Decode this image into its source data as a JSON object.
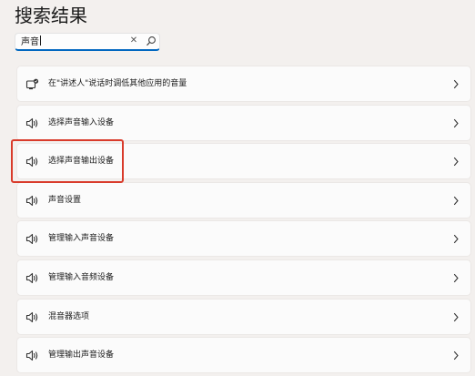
{
  "header": {
    "title": "搜索结果"
  },
  "search": {
    "value": "声音",
    "clear_icon": "close-icon",
    "search_icon": "search-icon"
  },
  "results": [
    {
      "label": "在\"讲述人\"说话时调低其他应用的音量",
      "icon": "narrator-icon"
    },
    {
      "label": "选择声音输入设备",
      "icon": "speaker-icon"
    },
    {
      "label": "选择声音输出设备",
      "icon": "speaker-icon",
      "highlighted": true
    },
    {
      "label": "声音设置",
      "icon": "speaker-icon"
    },
    {
      "label": "管理输入声音设备",
      "icon": "speaker-icon"
    },
    {
      "label": "管理输入音频设备",
      "icon": "speaker-icon"
    },
    {
      "label": "混音器选项",
      "icon": "speaker-icon"
    },
    {
      "label": "管理输出声音设备",
      "icon": "speaker-icon"
    }
  ],
  "colors": {
    "accent": "#0067c0",
    "highlight_border": "#d93b2b",
    "background": "#f3f0ee"
  }
}
